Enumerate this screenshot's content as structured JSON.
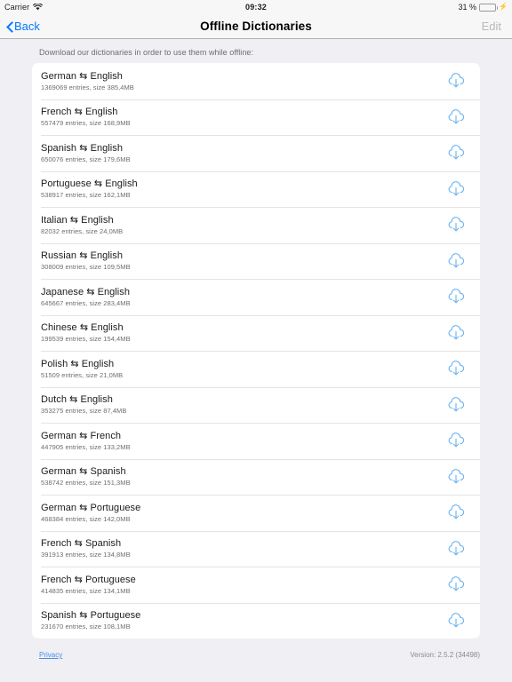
{
  "statusbar": {
    "carrier": "Carrier",
    "wifi_icon": "wifi-icon",
    "time": "09:32",
    "battery_percent": "31 %",
    "battery_level": 31,
    "battery_icon": "battery-icon",
    "charging_icon": "lightning-bolt-icon"
  },
  "navbar": {
    "back_label": "Back",
    "back_icon": "chevron-left-icon",
    "title": "Offline Dictionaries",
    "edit_label": "Edit"
  },
  "main": {
    "intro": "Download our dictionaries in order to use them while offline:",
    "download_icon": "cloud-download-icon",
    "arrow_glyph": "⇆",
    "accent_color": "#007aff",
    "icon_color": "#6fb5f0",
    "dictionaries": [
      {
        "title": "German ⇆ English",
        "source": "German",
        "target": "English",
        "subtitle": "1369069 entries, size 385,4MB",
        "entries": "1369069",
        "size": "385,4MB"
      },
      {
        "title": "French ⇆ English",
        "source": "French",
        "target": "English",
        "subtitle": "557479 entries, size 168,9MB",
        "entries": "557479",
        "size": "168,9MB"
      },
      {
        "title": "Spanish ⇆ English",
        "source": "Spanish",
        "target": "English",
        "subtitle": "650076 entries, size 179,6MB",
        "entries": "650076",
        "size": "179,6MB"
      },
      {
        "title": "Portuguese ⇆ English",
        "source": "Portuguese",
        "target": "English",
        "subtitle": "538917 entries, size 162,1MB",
        "entries": "538917",
        "size": "162,1MB"
      },
      {
        "title": "Italian ⇆ English",
        "source": "Italian",
        "target": "English",
        "subtitle": "82032 entries, size 24,0MB",
        "entries": "82032",
        "size": "24,0MB"
      },
      {
        "title": "Russian ⇆ English",
        "source": "Russian",
        "target": "English",
        "subtitle": "308009 entries, size 109,5MB",
        "entries": "308009",
        "size": "109,5MB"
      },
      {
        "title": "Japanese ⇆ English",
        "source": "Japanese",
        "target": "English",
        "subtitle": "645667 entries, size 283,4MB",
        "entries": "645667",
        "size": "283,4MB"
      },
      {
        "title": "Chinese ⇆ English",
        "source": "Chinese",
        "target": "English",
        "subtitle": "199539 entries, size 154,4MB",
        "entries": "199539",
        "size": "154,4MB"
      },
      {
        "title": "Polish ⇆ English",
        "source": "Polish",
        "target": "English",
        "subtitle": "51509 entries, size 21,0MB",
        "entries": "51509",
        "size": "21,0MB"
      },
      {
        "title": "Dutch ⇆ English",
        "source": "Dutch",
        "target": "English",
        "subtitle": "353275 entries, size 87,4MB",
        "entries": "353275",
        "size": "87,4MB"
      },
      {
        "title": "German ⇆ French",
        "source": "German",
        "target": "French",
        "subtitle": "447905 entries, size 133,2MB",
        "entries": "447905",
        "size": "133,2MB"
      },
      {
        "title": "German ⇆ Spanish",
        "source": "German",
        "target": "Spanish",
        "subtitle": "538742 entries, size 151,3MB",
        "entries": "538742",
        "size": "151,3MB"
      },
      {
        "title": "German ⇆ Portuguese",
        "source": "German",
        "target": "Portuguese",
        "subtitle": "468384 entries, size 142,0MB",
        "entries": "468384",
        "size": "142,0MB"
      },
      {
        "title": "French ⇆ Spanish",
        "source": "French",
        "target": "Spanish",
        "subtitle": "391913 entries, size 134,8MB",
        "entries": "391913",
        "size": "134,8MB"
      },
      {
        "title": "French ⇆ Portuguese",
        "source": "French",
        "target": "Portuguese",
        "subtitle": "414835 entries, size 134,1MB",
        "entries": "414835",
        "size": "134,1MB"
      },
      {
        "title": "Spanish ⇆ Portuguese",
        "source": "Spanish",
        "target": "Portuguese",
        "subtitle": "231670 entries, size 108,1MB",
        "entries": "231670",
        "size": "108,1MB"
      }
    ]
  },
  "footer": {
    "privacy_label": "Privacy",
    "version": "Version: 2.5.2 (34498)"
  }
}
